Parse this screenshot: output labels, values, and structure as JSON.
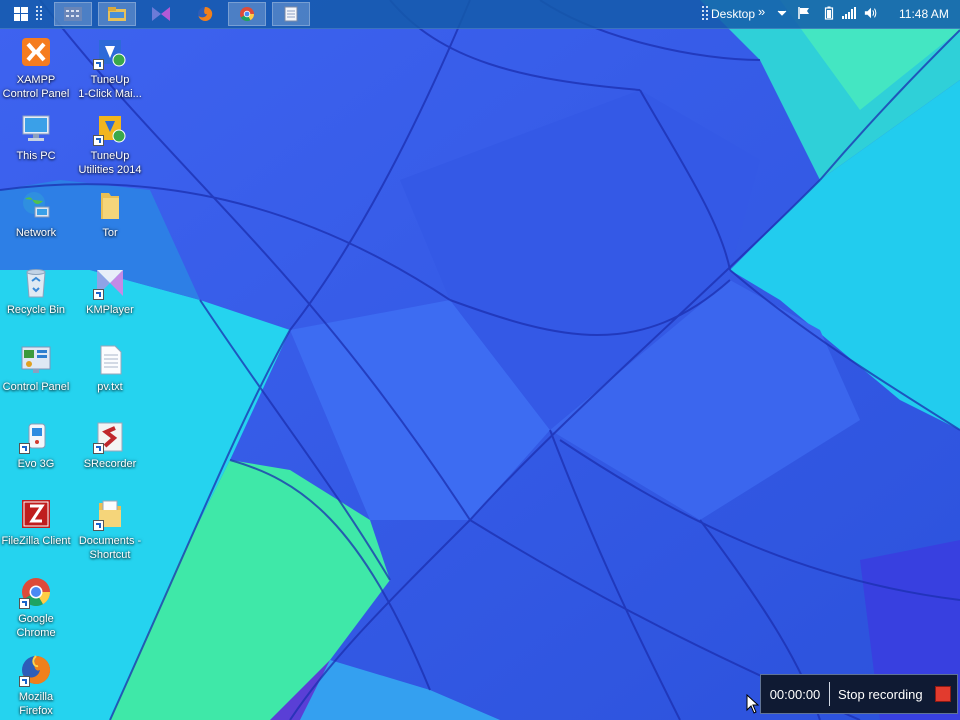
{
  "taskbar": {
    "tray": {
      "desktop_label": "Desktop",
      "overflow_label": "»",
      "clock": "11:48 AM"
    }
  },
  "desktop_icons": [
    {
      "label": "XAMPP\nControl Panel",
      "icon": "xampp-icon"
    },
    {
      "label": "TuneUp\n1-Click Mai...",
      "icon": "tuneup-1click-icon"
    },
    {
      "label": "This PC",
      "icon": "this-pc-icon"
    },
    {
      "label": "TuneUp\nUtilities 2014",
      "icon": "tuneup-utilities-icon"
    },
    {
      "label": "Network",
      "icon": "network-icon"
    },
    {
      "label": "Tor",
      "icon": "folder-icon"
    },
    {
      "label": "Recycle Bin",
      "icon": "recycle-bin-icon"
    },
    {
      "label": "KMPlayer",
      "icon": "kmplayer-icon"
    },
    {
      "label": "Control Panel",
      "icon": "control-panel-icon"
    },
    {
      "label": "pv.txt",
      "icon": "text-file-icon"
    },
    {
      "label": "Evo 3G",
      "icon": "evo-3g-icon"
    },
    {
      "label": "SRecorder",
      "icon": "srecorder-icon"
    },
    {
      "label": "FileZilla Client",
      "icon": "filezilla-icon"
    },
    {
      "label": "Documents -\nShortcut",
      "icon": "documents-shortcut-icon"
    },
    {
      "label": "Google\nChrome",
      "icon": "chrome-icon"
    },
    {
      "label": "Mozilla\nFirefox",
      "icon": "firefox-icon"
    }
  ],
  "recorder": {
    "elapsed": "00:00:00",
    "stop_label": "Stop recording"
  },
  "colors": {
    "wallpaper_blue": "#2f5fe8",
    "wallpaper_cyan": "#1fd6ee",
    "wallpaper_green": "#3fe6b0",
    "taskbar": "#145aaa",
    "record_red": "#e23b2e"
  }
}
